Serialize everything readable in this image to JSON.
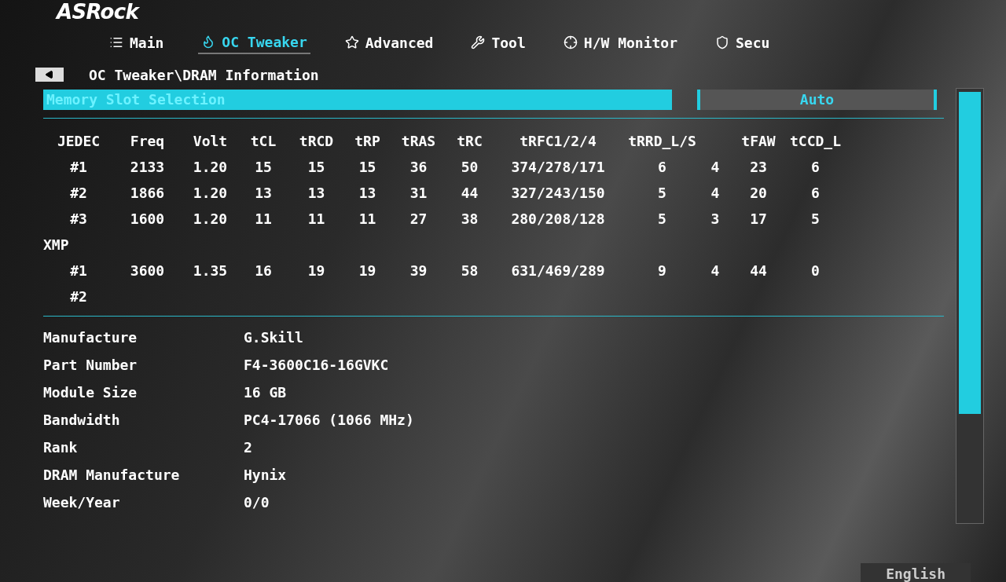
{
  "logo": "ASRock",
  "tabs": [
    {
      "label": "Main",
      "selected": false
    },
    {
      "label": "OC Tweaker",
      "selected": true
    },
    {
      "label": "Advanced",
      "selected": false
    },
    {
      "label": "Tool",
      "selected": false
    },
    {
      "label": "H/W Monitor",
      "selected": false
    },
    {
      "label": "Secu",
      "selected": false
    }
  ],
  "breadcrumb": "OC Tweaker\\DRAM Information",
  "setting": {
    "label": "Memory Slot Selection",
    "value": "Auto",
    "selected": true
  },
  "table": {
    "columns": [
      "JEDEC",
      "Freq",
      "Volt",
      "tCL",
      "tRCD",
      "tRP",
      "tRAS",
      "tRC",
      "tRFC1/2/4",
      "tRRD_L/S",
      "",
      "tFAW",
      "tCCD_L"
    ],
    "rows": [
      {
        "kind": "data",
        "cells": [
          "#1",
          "2133",
          "1.20",
          "15",
          "15",
          "15",
          "36",
          "50",
          "374/278/171",
          "6",
          "4",
          "23",
          "6"
        ]
      },
      {
        "kind": "data",
        "cells": [
          "#2",
          "1866",
          "1.20",
          "13",
          "13",
          "13",
          "31",
          "44",
          "327/243/150",
          "5",
          "4",
          "20",
          "6"
        ]
      },
      {
        "kind": "data",
        "cells": [
          "#3",
          "1600",
          "1.20",
          "11",
          "11",
          "11",
          "27",
          "38",
          "280/208/128",
          "5",
          "3",
          "17",
          "5"
        ]
      },
      {
        "kind": "section",
        "cells": [
          "XMP"
        ]
      },
      {
        "kind": "data",
        "cells": [
          "#1",
          "3600",
          "1.35",
          "16",
          "19",
          "19",
          "39",
          "58",
          "631/469/289",
          "9",
          "4",
          "44",
          "0"
        ]
      },
      {
        "kind": "data",
        "cells": [
          "#2"
        ]
      }
    ]
  },
  "info": [
    {
      "label": "Manufacture",
      "value": "G.Skill"
    },
    {
      "label": "Part Number",
      "value": "F4-3600C16-16GVKC"
    },
    {
      "label": "Module Size",
      "value": "16 GB"
    },
    {
      "label": "Bandwidth",
      "value": "PC4-17066 (1066 MHz)"
    },
    {
      "label": "Rank",
      "value": "2"
    },
    {
      "label": "DRAM Manufacture",
      "value": "Hynix"
    },
    {
      "label": "Week/Year",
      "value": "0/0"
    }
  ],
  "language": "English"
}
